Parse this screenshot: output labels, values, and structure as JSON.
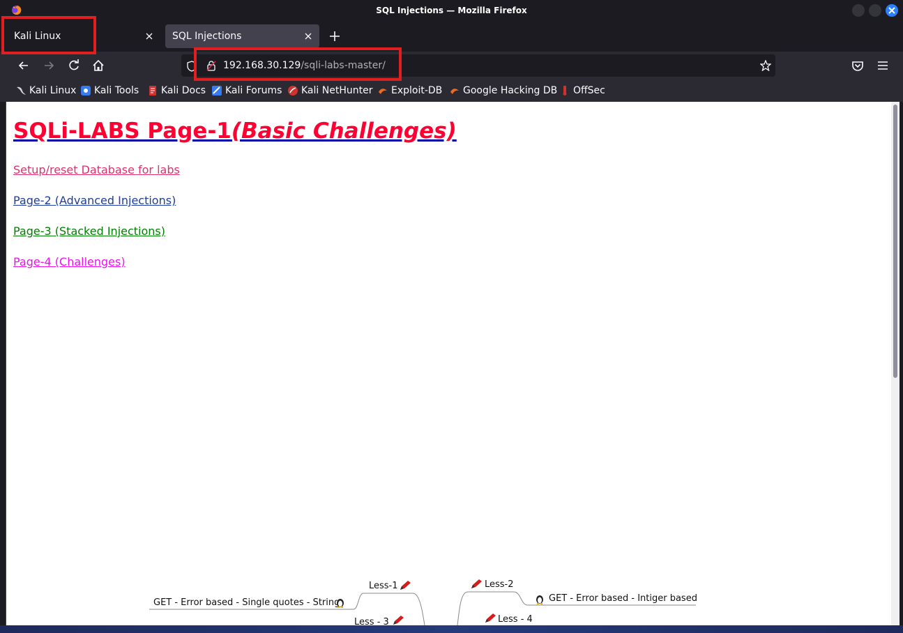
{
  "window": {
    "title": "SQL Injections — Mozilla Firefox"
  },
  "tabs": [
    {
      "label": "Kali Linux",
      "active": false
    },
    {
      "label": "SQL Injections",
      "active": true
    }
  ],
  "urlbar": {
    "host": "192.168.30.129",
    "path": "/sqli-labs-master/"
  },
  "bookmarks": [
    {
      "label": "Kali Linux",
      "icon": "kali-dragon-icon"
    },
    {
      "label": "Kali Tools",
      "icon": "kali-tools-icon"
    },
    {
      "label": "Kali Docs",
      "icon": "kali-docs-icon"
    },
    {
      "label": "Kali Forums",
      "icon": "kali-forums-icon"
    },
    {
      "label": "Kali NetHunter",
      "icon": "kali-nethunter-icon"
    },
    {
      "label": "Exploit-DB",
      "icon": "exploit-db-icon"
    },
    {
      "label": "Google Hacking DB",
      "icon": "ghdb-icon"
    },
    {
      "label": "OffSec",
      "icon": "offsec-icon"
    }
  ],
  "page": {
    "heading_main": "SQLi-LABS Page-1",
    "heading_italic": "(Basic Challenges)",
    "links": {
      "setup": "Setup/reset Database for labs",
      "page2": "Page-2 (Advanced Injections)",
      "page3": "Page-3 (Stacked Injections)",
      "page4": "Page-4 (Challenges)"
    },
    "mindmap": {
      "less1": "Less-1",
      "less1_desc": "GET - Error based - Single quotes - String",
      "less2": "Less-2",
      "less2_desc": "GET - Error based - Intiger based",
      "less3": "Less - 3",
      "less4": "Less - 4"
    }
  },
  "colors": {
    "accent_red": "#ff0033",
    "annotation_red": "#e02020"
  }
}
